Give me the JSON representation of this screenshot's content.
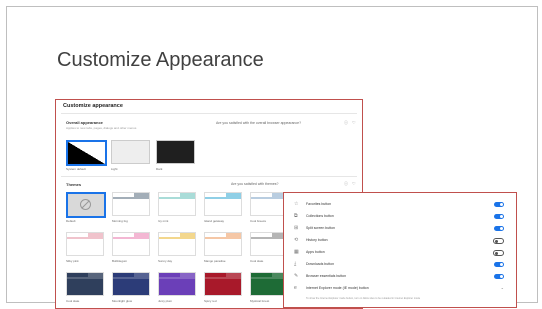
{
  "slide": {
    "title": "Customize Appearance"
  },
  "screenshot": {
    "title": "Customize appearance",
    "overall": {
      "title": "Overall appearance",
      "subtitle": "Applies to new tabs, pages, dialogs and other menus",
      "question": "Are you satisfied with the overall browser appearance?",
      "options": [
        {
          "label": "System default",
          "color": "#000000",
          "style": "split",
          "selected": true
        },
        {
          "label": "Light",
          "color": "#eeeeee",
          "style": "light",
          "selected": false
        },
        {
          "label": "Dark",
          "color": "#1f1f1f",
          "style": "dark",
          "selected": false
        }
      ]
    },
    "themes": {
      "title": "Themes",
      "question": "Are you satisfied with themes?",
      "items": [
        {
          "label": "Default",
          "color": "#d9d9d9",
          "disabled": true,
          "selected": true
        },
        {
          "label": "Morning fog",
          "color": "#a3aeb8"
        },
        {
          "label": "Icy mint",
          "color": "#a9dcd8"
        },
        {
          "label": "Island getaway",
          "color": "#8fcfe6"
        },
        {
          "label": "Cool breeze",
          "color": "#b9cde0"
        },
        {
          "label": "Silky pink",
          "color": "#f0c3cc"
        },
        {
          "label": "Bubblegum",
          "color": "#f3b7d3"
        },
        {
          "label": "Sunny day",
          "color": "#f3d78d"
        },
        {
          "label": "Mango paradise",
          "color": "#f5c7a6"
        },
        {
          "label": "Cool slate",
          "color": "#b5b5b5"
        },
        {
          "label": "Cool slate",
          "color": "#2f3f5c"
        },
        {
          "label": "Moonlight glow",
          "color": "#2c3c78"
        },
        {
          "label": "Juicy plum",
          "color": "#6b3fb8"
        },
        {
          "label": "Spicy red",
          "color": "#a8192a"
        },
        {
          "label": "Mystical forest",
          "color": "#1e6b36"
        }
      ]
    }
  },
  "toolbar_panel": {
    "rows": [
      {
        "icon": "☆",
        "label": "Favorites button",
        "state": "on"
      },
      {
        "icon": "⧉",
        "label": "Collections button",
        "state": "on"
      },
      {
        "icon": "⊞",
        "label": "Split screen button",
        "state": "on"
      },
      {
        "icon": "⟲",
        "label": "History button",
        "state": "off"
      },
      {
        "icon": "▦",
        "label": "Apps button",
        "state": "off"
      },
      {
        "icon": "⤓",
        "label": "Downloads button",
        "state": "on"
      },
      {
        "icon": "✎",
        "label": "Browser essentials button",
        "state": "on"
      },
      {
        "icon": "e",
        "label": "Internet Explorer mode (IE mode) button",
        "state": "dropdown"
      }
    ],
    "ie_subtext": "To show the Internet Explorer mode button, turn on Allow sites to be reloaded in Internet Explorer mode",
    "dropdown_glyph": "⌄"
  },
  "icons": {
    "info": "ⓘ",
    "feedback": "♡"
  }
}
